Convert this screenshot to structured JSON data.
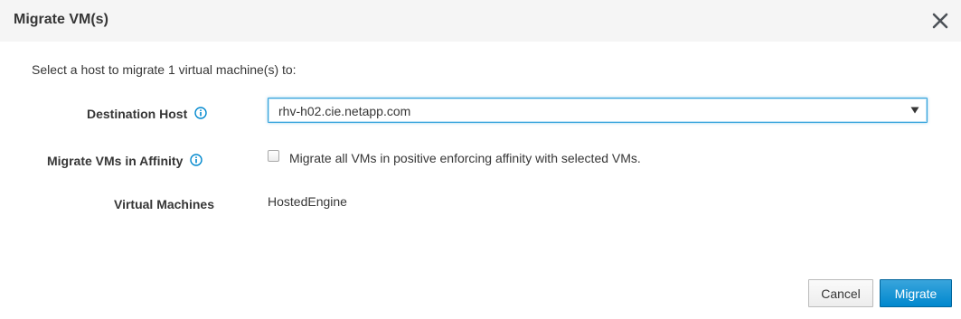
{
  "dialog": {
    "title": "Migrate VM(s)",
    "intro": "Select a host to migrate 1 virtual machine(s) to:"
  },
  "destination_host": {
    "label": "Destination Host",
    "value": "rhv-h02.cie.netapp.com"
  },
  "affinity": {
    "label": "Migrate VMs in Affinity",
    "checkbox_label": "Migrate all VMs in positive enforcing affinity with selected VMs.",
    "checked": false
  },
  "virtual_machines": {
    "label": "Virtual Machines",
    "value": "HostedEngine"
  },
  "footer": {
    "cancel_label": "Cancel",
    "migrate_label": "Migrate"
  },
  "colors": {
    "primary": "#0088ce",
    "info_icon": "#0088ce",
    "header_bg": "#f5f5f5"
  },
  "icons": {
    "close": "close-icon",
    "info": "info-icon",
    "caret": "caret-down-icon"
  }
}
